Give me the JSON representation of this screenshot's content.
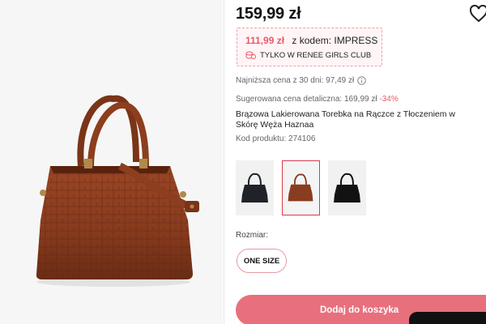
{
  "product": {
    "price": "159,99 zł",
    "promo": {
      "price": "111,99 zł",
      "code_text": "z kodem: IMPRESS",
      "club_text": "TYLKO W RENEE GIRLS CLUB"
    },
    "lowest_price_text": "Najniższa cena z 30 dni: 97,49 zł",
    "suggested_text": "Sugerowana cena detaliczna: 169,99 zł",
    "discount": "-34%",
    "title": "Brązowa Lakierowana Torebka na Rączce z Tłoczeniem w Skórę Węża Haznaa",
    "code_text": "Kod produktu: 274106"
  },
  "variants": [
    {
      "color": "#1f2228",
      "selected": false
    },
    {
      "color": "#8a3c20",
      "selected": true
    },
    {
      "color": "#121212",
      "selected": false
    }
  ],
  "size": {
    "label": "Rozmiar:",
    "option": "ONE SIZE"
  },
  "cart": {
    "button_label": "Dodaj do koszyka"
  },
  "colors": {
    "accent": "#e8707c",
    "discount": "#e85a6a",
    "bag_brown": "#8a3c20"
  },
  "icons": [
    "heart-icon",
    "coin-icon",
    "info-icon"
  ]
}
